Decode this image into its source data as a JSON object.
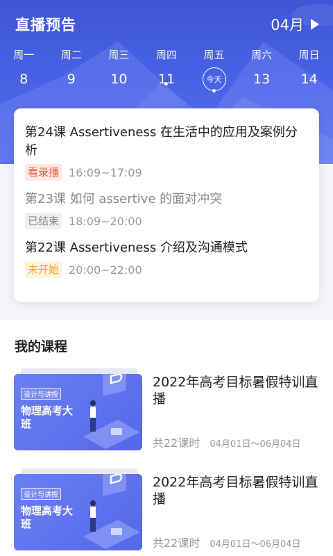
{
  "header": {
    "title": "直播预告",
    "month": "04月",
    "week": [
      {
        "weekday": "周一",
        "date": "8",
        "has_dot": false,
        "today": false
      },
      {
        "weekday": "周二",
        "date": "9",
        "has_dot": false,
        "today": false
      },
      {
        "weekday": "周三",
        "date": "10",
        "has_dot": false,
        "today": false
      },
      {
        "weekday": "周四",
        "date": "11",
        "has_dot": true,
        "today": false
      },
      {
        "weekday": "周五",
        "date": "今天",
        "has_dot": true,
        "today": true
      },
      {
        "weekday": "周六",
        "date": "13",
        "has_dot": false,
        "today": false
      },
      {
        "weekday": "周日",
        "date": "14",
        "has_dot": false,
        "today": false
      }
    ]
  },
  "schedule": [
    {
      "title": "第24课 Assertiveness 在生活中的应用及案例分析",
      "status": "看录播",
      "time": "16:09~17:09"
    },
    {
      "title": "第23课 如何 assertive 的面对冲突",
      "status": "已结束",
      "time": "18:09~20:00"
    },
    {
      "title": "第22课 Assertiveness 介绍及沟通模式",
      "status": "未开始",
      "time": "20:00~22:00"
    }
  ],
  "my_courses": {
    "title": "我的课程",
    "items": [
      {
        "thumb_tag": "设计与讲授",
        "thumb_title": "物理高考大班",
        "name": "2022年高考目标暑假特训直播",
        "lessons": "共22课时",
        "dates": "04月01日～06月04日"
      },
      {
        "thumb_tag": "设计与讲授",
        "thumb_title": "物理高考大班",
        "name": "2022年高考目标暑假特训直播",
        "lessons": "共22课时",
        "dates": "04月01日～06月04日"
      }
    ]
  },
  "colors": {
    "header_blue": "#4a63e6",
    "replay_red": "#f05a3a",
    "upcoming_orange": "#f5a623"
  }
}
